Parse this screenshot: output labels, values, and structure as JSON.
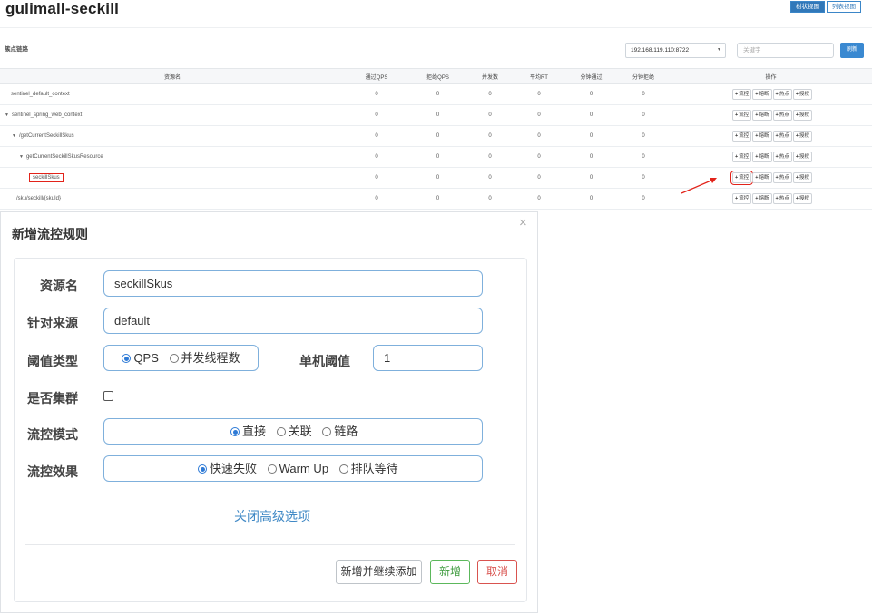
{
  "header": {
    "title": "gulimall-seckill",
    "tree_view": "树状视图",
    "list_view": "列表视图"
  },
  "toolbar": {
    "nodes_label": "簇点链路",
    "machine": "192.168.119.110:8722",
    "search_placeholder": "关键字",
    "refresh": "刷新"
  },
  "table": {
    "columns": [
      "资源名",
      "通过QPS",
      "拒绝QPS",
      "并发数",
      "平均RT",
      "分钟通过",
      "分钟拒绝",
      "操作"
    ],
    "ops": [
      "流控",
      "熔断",
      "热点",
      "授权"
    ],
    "rows": [
      {
        "name": "sentinel_default_context",
        "values": [
          "0",
          "0",
          "0",
          "0",
          "0",
          "0"
        ]
      },
      {
        "name": "sentinel_spring_web_context",
        "values": [
          "0",
          "0",
          "0",
          "0",
          "0",
          "0"
        ]
      },
      {
        "name": "/getCurrentSeckillSkus",
        "values": [
          "0",
          "0",
          "0",
          "0",
          "0",
          "0"
        ]
      },
      {
        "name": "getCurrentSeckillSkusResource",
        "values": [
          "0",
          "0",
          "0",
          "0",
          "0",
          "0"
        ]
      },
      {
        "name": "seckillSkus",
        "values": [
          "0",
          "0",
          "0",
          "0",
          "0",
          "0"
        ]
      },
      {
        "name": "/sku/seckill/{skuId}",
        "values": [
          "0",
          "0",
          "0",
          "0",
          "0",
          "0"
        ]
      }
    ]
  },
  "modal": {
    "title": "新增流控规则",
    "close": "×",
    "resource_label": "资源名",
    "resource_value": "seckillSkus",
    "origin_label": "针对来源",
    "origin_value": "default",
    "threshold_type_label": "阈值类型",
    "threshold_type_options": [
      "QPS",
      "并发线程数"
    ],
    "threshold_label": "单机阈值",
    "threshold_value": "1",
    "cluster_label": "是否集群",
    "mode_label": "流控模式",
    "mode_options": [
      "直接",
      "关联",
      "链路"
    ],
    "effect_label": "流控效果",
    "effect_options": [
      "快速失败",
      "Warm Up",
      "排队等待"
    ],
    "advanced_link": "关闭高级选项",
    "btn_continue": "新增并继续添加",
    "btn_add": "新增",
    "btn_cancel": "取消"
  }
}
